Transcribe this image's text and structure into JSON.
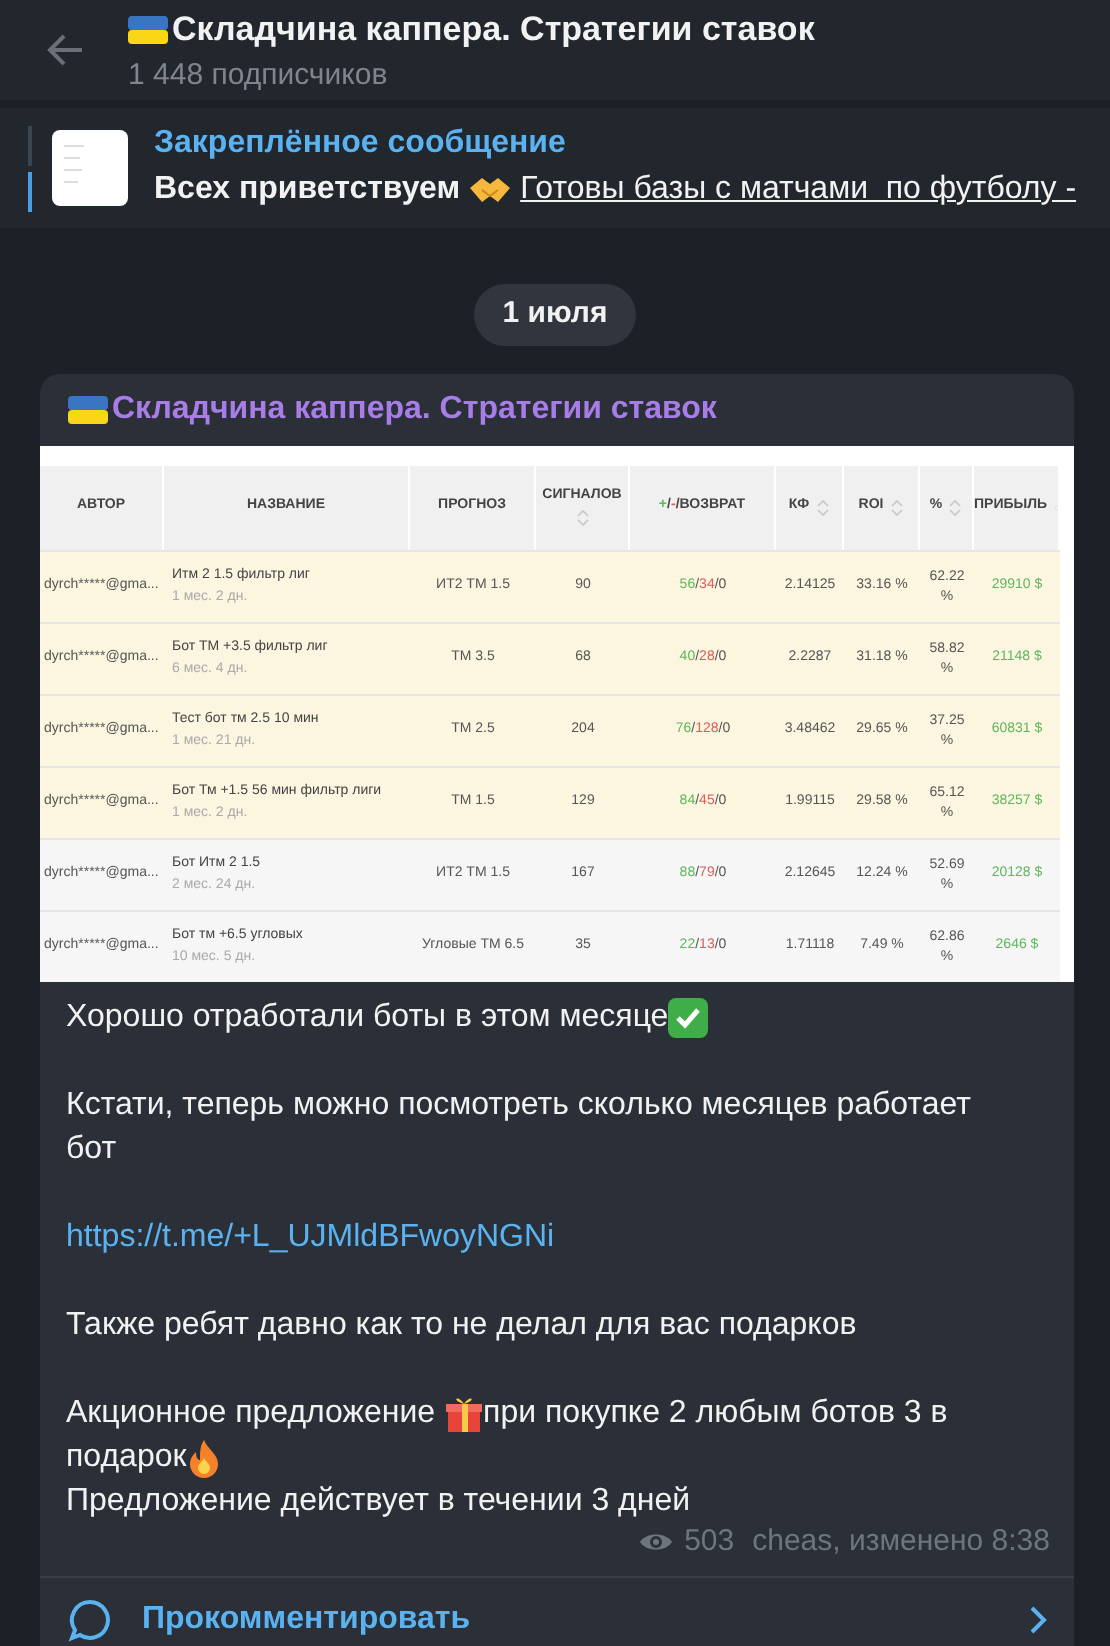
{
  "header": {
    "title": "Складчина каппера. Стратегии ставок",
    "subtitle": "1 448 подписчиков"
  },
  "pinned": {
    "label": "Закреплённое сообщение",
    "text": "Всех приветствуем",
    "link": "Готовы базы с матчами  по футболу -"
  },
  "date": "1 июля",
  "message": {
    "author": "Складчина каппера. Стратегии ставок",
    "table": {
      "columns": [
        {
          "label": "АВТОР",
          "sortable": false
        },
        {
          "label": "НАЗВАНИЕ",
          "sortable": false
        },
        {
          "label": "ПРОГНОЗ",
          "sortable": false
        },
        {
          "label": "СИГНАЛОВ",
          "sortable": true
        },
        {
          "label": "+/-/ВОЗВРАТ",
          "sortable": false
        },
        {
          "label": "КФ",
          "sortable": true
        },
        {
          "label": "ROI",
          "sortable": true
        },
        {
          "label": "%",
          "sortable": true
        },
        {
          "label": "ПРИБЫЛЬ",
          "sortable": true
        }
      ],
      "rows": [
        {
          "highlighted": true,
          "author": "dyrch*****@gma...",
          "name": "Итм 2 1.5 фильтр лиг",
          "age": "1 мес. 2 дн.",
          "forecast": "ИТ2 ТМ 1.5",
          "signals": "90",
          "result": "56/34/0",
          "kf": "2.14125",
          "roi": "33.16 %",
          "pct": "62.22 %",
          "profit": "29910 $"
        },
        {
          "highlighted": true,
          "author": "dyrch*****@gma...",
          "name": "Бот ТМ +3.5 фильтр лиг",
          "age": "6 мес. 4 дн.",
          "forecast": "ТМ 3.5",
          "signals": "68",
          "result": "40/28/0",
          "kf": "2.2287",
          "roi": "31.18 %",
          "pct": "58.82 %",
          "profit": "21148 $"
        },
        {
          "highlighted": true,
          "author": "dyrch*****@gma...",
          "name": "Тест бот тм 2.5 10 мин",
          "age": "1 мес. 21 дн.",
          "forecast": "ТМ 2.5",
          "signals": "204",
          "result": "76/128/0",
          "kf": "3.48462",
          "roi": "29.65 %",
          "pct": "37.25 %",
          "profit": "60831 $"
        },
        {
          "highlighted": true,
          "author": "dyrch*****@gma...",
          "name": "Бот Тм +1.5 56 мин фильтр лиги",
          "age": "1 мес. 2 дн.",
          "forecast": "ТМ 1.5",
          "signals": "129",
          "result": "84/45/0",
          "kf": "1.99115",
          "roi": "29.58 %",
          "pct": "65.12 %",
          "profit": "38257 $"
        },
        {
          "highlighted": false,
          "author": "dyrch*****@gma...",
          "name": "Бот Итм 2 1.5",
          "age": "2 мес. 24 дн.",
          "forecast": "ИТ2 ТМ 1.5",
          "signals": "167",
          "result": "88/79/0",
          "kf": "2.12645",
          "roi": "12.24 %",
          "pct": "52.69 %",
          "profit": "20128 $"
        },
        {
          "highlighted": false,
          "author": "dyrch*****@gma...",
          "name": "Бот тм +6.5 угловых",
          "age": "10 мес. 5 дн.",
          "forecast": "Угловые ТМ 6.5",
          "signals": "35",
          "result": "22/13/0",
          "kf": "1.71118",
          "roi": "7.49 %",
          "pct": "62.86 %",
          "profit": "2646 $"
        }
      ]
    },
    "paragraphs": [
      {
        "kind": "check",
        "lines": [
          [
            "Хорошо отработали боты в этом месяце"
          ]
        ]
      },
      {
        "kind": "plain",
        "lines": [
          [
            "Кстати, теперь можно посмотреть сколько месяцев работает бот"
          ]
        ]
      },
      {
        "kind": "link",
        "lines": [
          [
            "https://t.me/+L_UJMldBFwoyNGNi"
          ]
        ]
      },
      {
        "kind": "plain",
        "lines": [
          [
            "Также ребят давно как то не делал для вас подарков"
          ]
        ]
      },
      {
        "kind": "offer",
        "lines": [
          [
            "Акционное предложение",
            "при покупке 2 любым ботов 3 в"
          ],
          [
            "подарок"
          ],
          [
            "Предложение действует в течении 3 дней"
          ]
        ]
      }
    ],
    "views": "503",
    "signature": "cheas, изменено 8:38"
  },
  "comment": "Прокомментировать"
}
